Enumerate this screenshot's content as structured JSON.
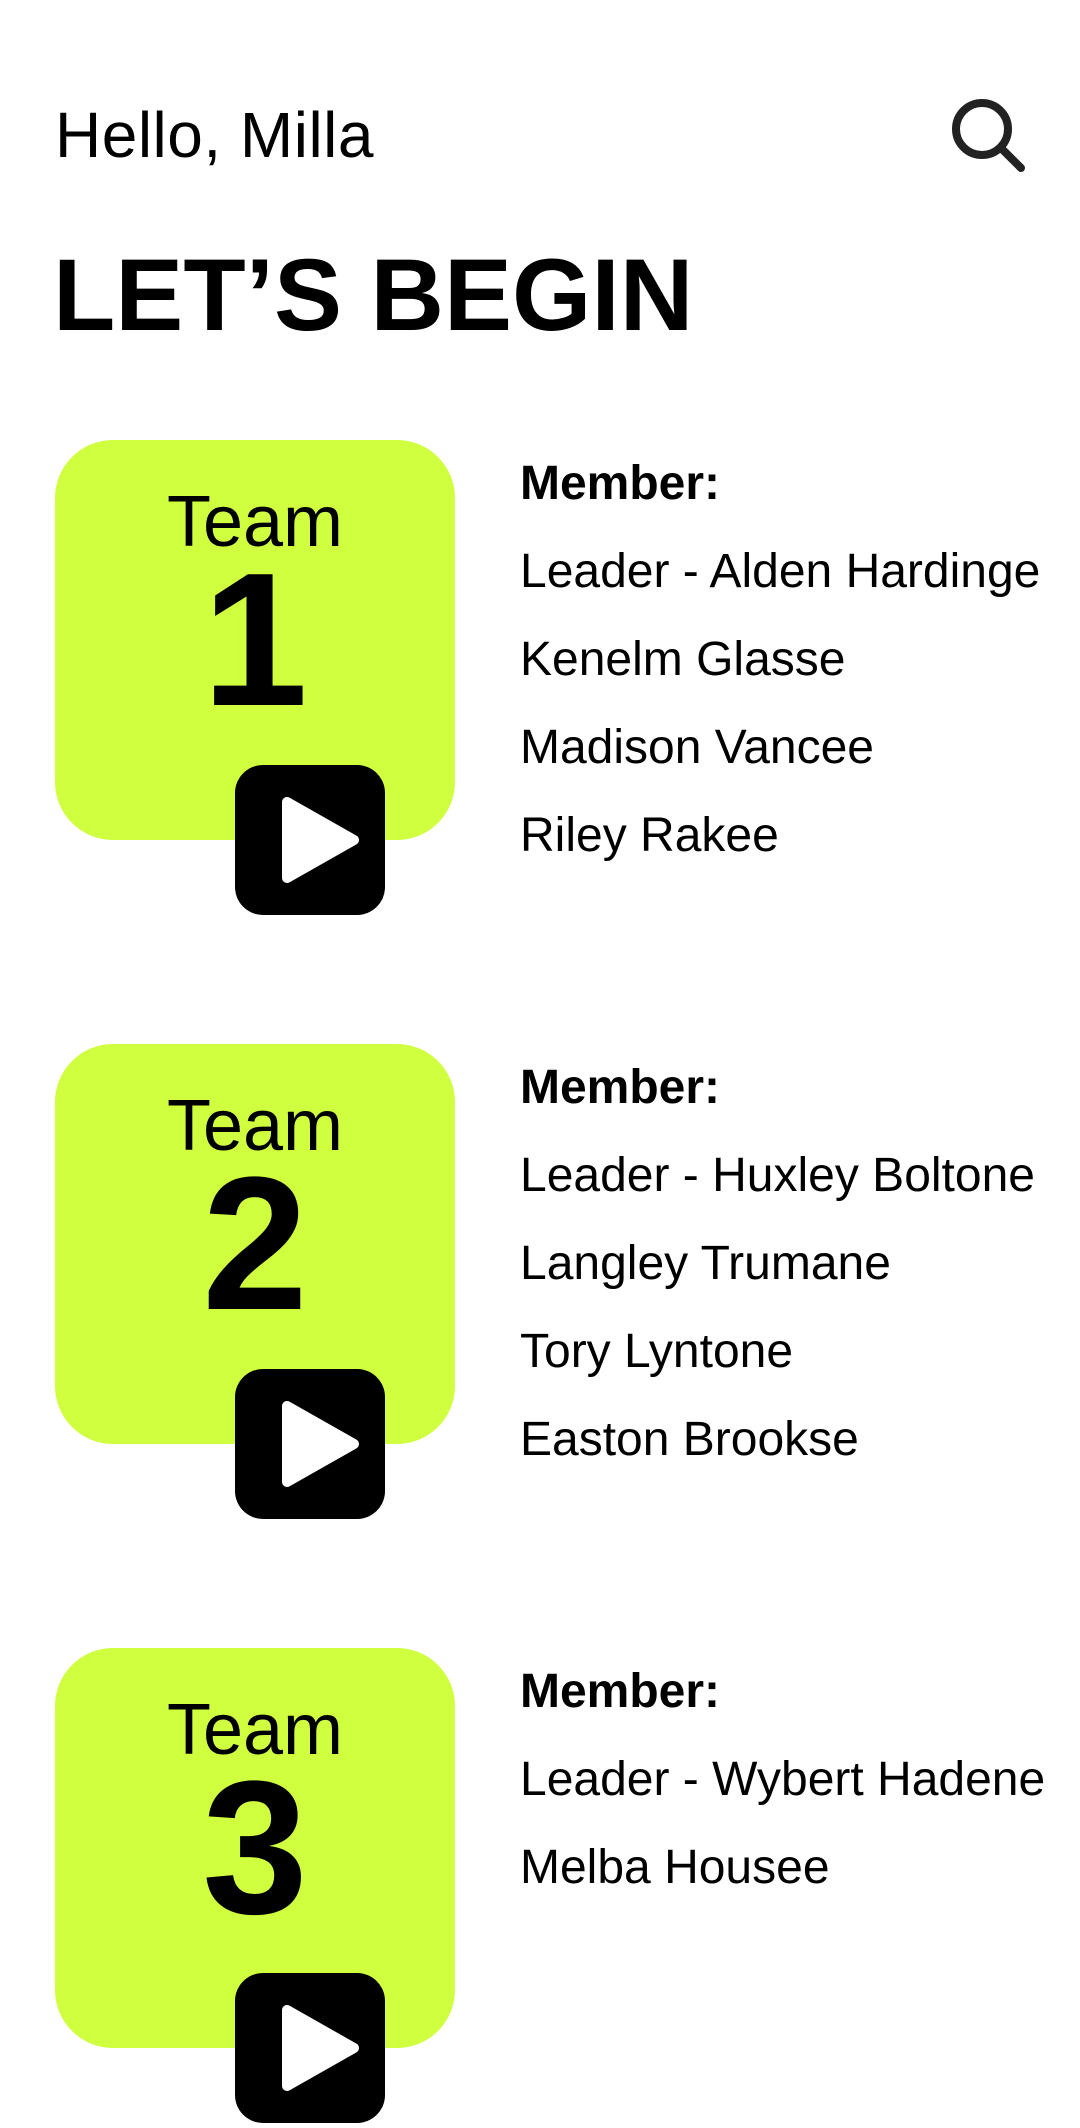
{
  "header": {
    "greeting": "Hello, Milla",
    "search_icon": "search-icon"
  },
  "page_title": "LET’S BEGIN",
  "colors": {
    "card_accent": "#d0ff3f",
    "play_button": "#000000",
    "text": "#000000"
  },
  "teams": [
    {
      "team_word": "Team",
      "number": "1",
      "members_heading": "Member:",
      "members": [
        "Leader - Alden Hardinge",
        "Kenelm Glasse",
        "Madison Vancee",
        "Riley Rakee"
      ],
      "play_icon": "play-icon"
    },
    {
      "team_word": "Team",
      "number": "2",
      "members_heading": "Member:",
      "members": [
        "Leader - Huxley Boltone",
        "Langley Trumane",
        "Tory Lyntone",
        "Easton Brookse"
      ],
      "play_icon": "play-icon"
    },
    {
      "team_word": "Team",
      "number": "3",
      "members_heading": "Member:",
      "members": [
        "Leader - Wybert Hadene",
        "Melba Housee"
      ],
      "play_icon": "play-icon"
    }
  ]
}
